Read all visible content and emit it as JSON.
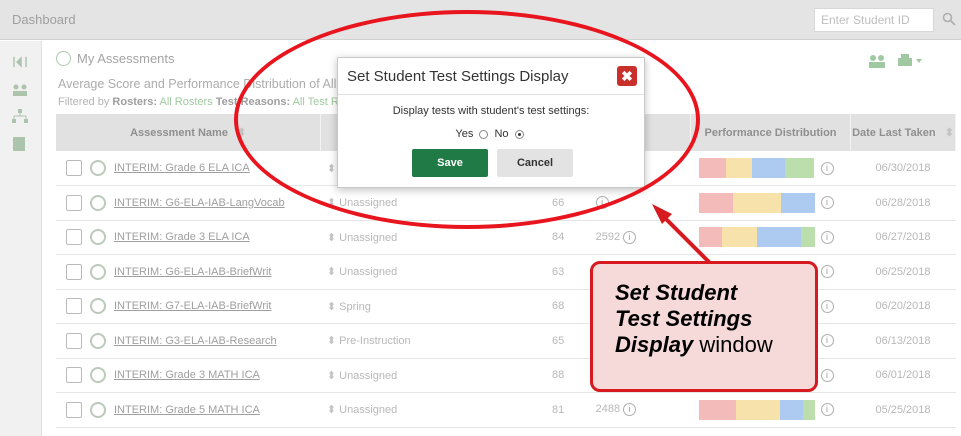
{
  "header": {
    "dashboard": "Dashboard",
    "student_id_placeholder": "Enter Student ID"
  },
  "section": {
    "title": "My Assessments",
    "subtitle": "Average Score and Performance Distribution of All Ro",
    "filters_prefix": "Filtered by",
    "rosters_label": "Rosters:",
    "rosters_value": "All Rosters",
    "test_reasons_label": "Test Reasons:",
    "test_reasons_value": "All Test R"
  },
  "table": {
    "col_name": "Assessment Name",
    "col_perf": "Performance Distribution",
    "col_date": "Date Last Taken",
    "rows": [
      {
        "name": "INTERIM: Grade 6 ELA ICA",
        "reason": "S",
        "avg": "",
        "count": "",
        "perf": [
          30,
          28,
          35,
          32
        ],
        "labels": [
          "30%",
          "28%",
          "35%",
          "32%"
        ],
        "date": "06/30/2018"
      },
      {
        "name": "INTERIM: G6-ELA-IAB-LangVocab",
        "reason": "Unassigned",
        "avg": "66",
        "count": "",
        "perf": [
          30,
          41,
          29
        ],
        "labels": [
          "30%",
          "41%",
          "28%"
        ],
        "date": "06/28/2018"
      },
      {
        "name": "INTERIM: Grade 3 ELA ICA",
        "reason": "Unassigned",
        "avg": "84",
        "count": "2592",
        "perf": [
          20,
          30,
          38,
          12
        ],
        "labels": [
          "20%",
          "30%",
          "38%",
          "12%"
        ],
        "date": "06/27/2018"
      },
      {
        "name": "INTERIM: G6-ELA-IAB-BriefWrit",
        "reason": "Unassigned",
        "avg": "63",
        "count": "",
        "perf": [],
        "labels": [],
        "date": "06/25/2018"
      },
      {
        "name": "INTERIM: G7-ELA-IAB-BriefWrit",
        "reason": "Spring",
        "avg": "68",
        "count": "",
        "perf": [],
        "labels": [],
        "date": "06/20/2018"
      },
      {
        "name": "INTERIM: G3-ELA-IAB-Research",
        "reason": "Pre-Instruction",
        "avg": "65",
        "count": "",
        "perf": [],
        "labels": [],
        "date": "06/13/2018"
      },
      {
        "name": "INTERIM: Grade 3 MATH ICA",
        "reason": "Unassigned",
        "avg": "88",
        "count": "",
        "perf": [],
        "labels": [],
        "date": "06/01/2018"
      },
      {
        "name": "INTERIM: Grade 5 MATH ICA",
        "reason": "Unassigned",
        "avg": "81",
        "count": "2488",
        "perf": [
          32,
          38,
          20,
          10
        ],
        "labels": [
          "32%",
          "38%",
          "20%",
          "10%"
        ],
        "date": "05/25/2018"
      }
    ]
  },
  "modal": {
    "title": "Set Student Test Settings Display",
    "close": "✖",
    "question": "Display tests with student's test settings:",
    "yes": "Yes",
    "no": "No",
    "selected": "No",
    "save": "Save",
    "cancel": "Cancel"
  },
  "callout": {
    "line1": "Set Student",
    "line2": "Test Settings",
    "line3_em": "Display",
    "line3_rest": " window"
  },
  "colors": {
    "accent_red": "#d71920",
    "save_green": "#1f7a45",
    "perf": [
      "#f4b8b8",
      "#f8e1a8",
      "#a9c8f0",
      "#b9dca8"
    ]
  }
}
